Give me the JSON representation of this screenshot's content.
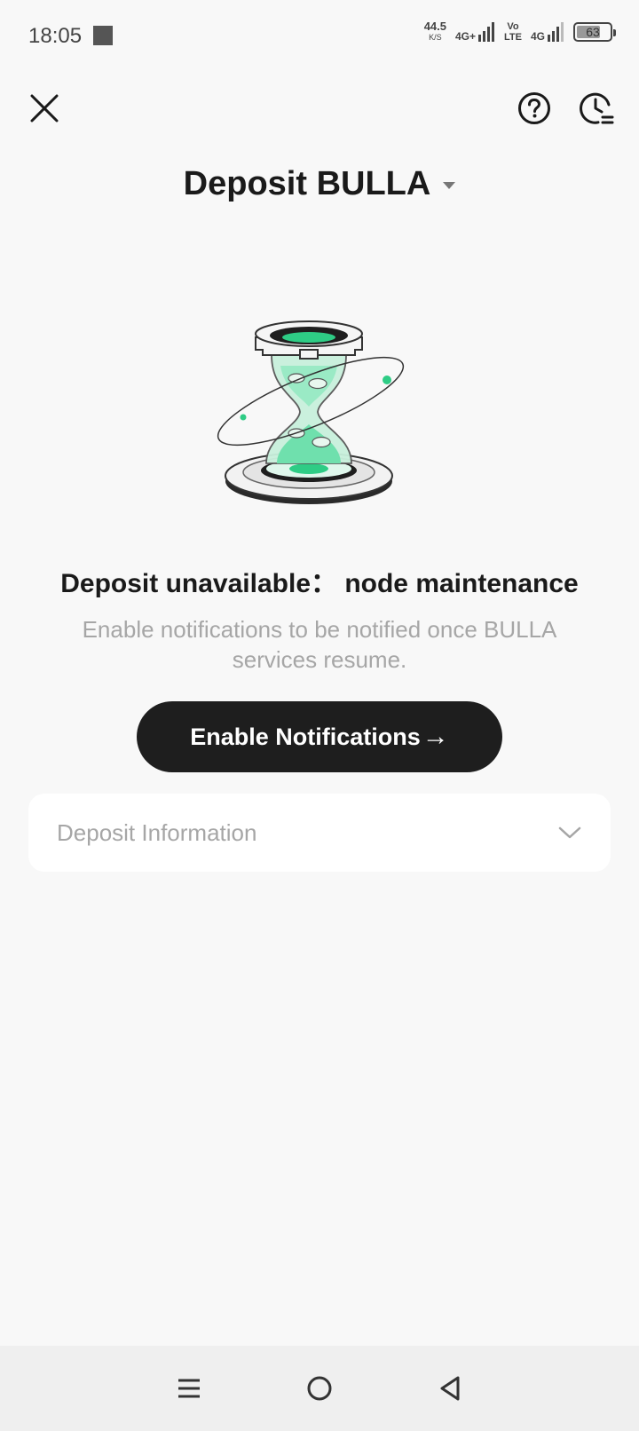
{
  "status_bar": {
    "time": "18:05",
    "net_speed_value": "44.5",
    "net_speed_unit": "K/S",
    "signal1_label": "4G+",
    "volte_top": "Vo",
    "volte_bottom": "LTE",
    "signal2_label": "4G",
    "battery_level": "63"
  },
  "header": {
    "title": "Deposit BULLA",
    "icons": [
      "close-icon",
      "help-icon",
      "history-icon",
      "caret-down-icon"
    ]
  },
  "main": {
    "illustration": "hourglass-illustration",
    "headline": "Deposit unavailable： node maintenance",
    "subtext": "Enable notifications to be notified once BULLA services resume.",
    "cta_label": "Enable Notifications",
    "cta_arrow": "→",
    "info_label": "Deposit Information"
  },
  "colors": {
    "accent_green": "#2ecc85",
    "button_bg": "#1e1e1e",
    "muted_text": "#a6a6a6"
  },
  "nav_bar": {
    "icons": [
      "menu-icon",
      "home-icon",
      "back-icon"
    ]
  }
}
